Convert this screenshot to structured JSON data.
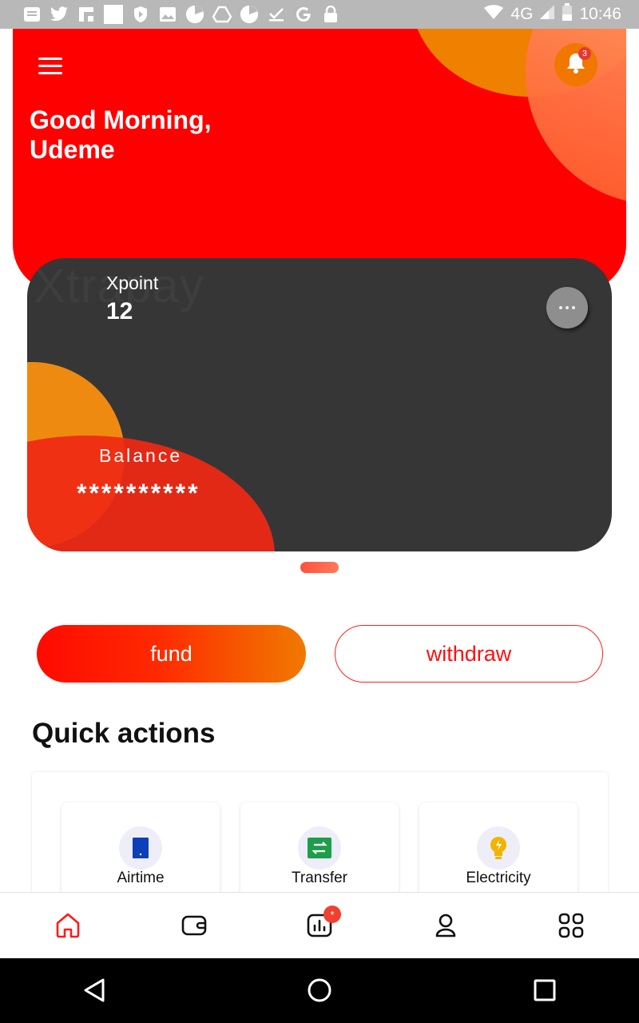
{
  "status_bar": {
    "time": "10:46",
    "network": "4G",
    "icons": [
      "news-icon",
      "twitter-icon",
      "flipboard-icon",
      "blank-square-icon",
      "shield-play-icon",
      "image-icon",
      "pie-chart-icon",
      "drive-icon",
      "pie-chart-icon",
      "download-done-icon",
      "google-icon",
      "lock-icon"
    ]
  },
  "header": {
    "greeting_line1": "Good Morning,",
    "greeting_line2": "Udeme",
    "notification_count": "3",
    "bg_color": "#ff0000"
  },
  "card": {
    "watermark": "Xtrapay",
    "points_label": "Xpoint",
    "points_value": "12",
    "balance_label": "Balance",
    "balance_value": "**********"
  },
  "actions": {
    "fund_label": "fund",
    "withdraw_label": "withdraw"
  },
  "quick_actions": {
    "title": "Quick actions",
    "items": [
      {
        "label": "Airtime",
        "icon": "phone-icon",
        "color": "#0d3fb8"
      },
      {
        "label": "Transfer",
        "icon": "transfer-icon",
        "color": "#1e9e4a"
      },
      {
        "label": "Electricity",
        "icon": "bulb-icon",
        "color": "#f2b400"
      }
    ]
  },
  "bottom_nav": {
    "items": [
      "home-icon",
      "wallet-icon",
      "stats-icon",
      "profile-icon",
      "grid-icon"
    ],
    "active": "home-icon",
    "stats_badge": "*"
  }
}
